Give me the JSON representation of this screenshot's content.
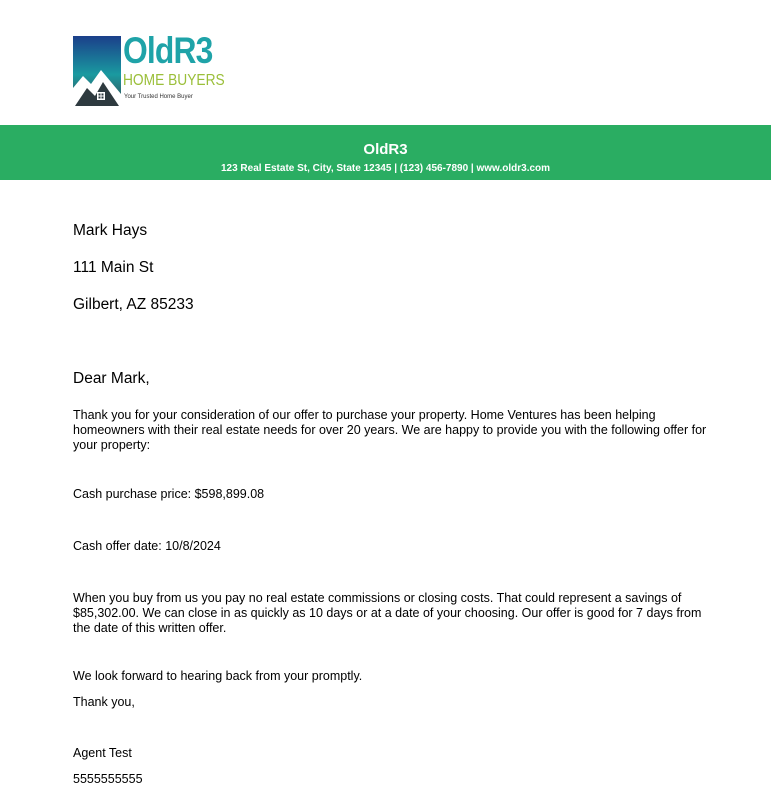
{
  "logo": {
    "name": "OldR3",
    "subtitle": "HOME BUYERS",
    "tagline": "Your Trusted Home Buyer",
    "colors": {
      "teal": "#1fa3a8",
      "green": "#9bbf3a",
      "navy": "#1b3f8a",
      "dark": "#2e3a3f"
    }
  },
  "header": {
    "company": "OldR3",
    "contact_line": "123 Real Estate St, City, State 12345 | (123) 456-7890 | www.oldr3.com",
    "background": "#2aad62"
  },
  "recipient": {
    "name": "Mark Hays",
    "street": "111 Main St",
    "city_state_zip": "Gilbert, AZ 85233"
  },
  "letter": {
    "salutation": "Dear Mark,",
    "intro": "Thank you for your consideration of our offer to purchase your property. Home Ventures has been helping homeowners with their real estate needs for over 20 years. We are happy to provide you with the following offer for your property:",
    "cash_price": "Cash purchase price: $598,899.08",
    "offer_date": "Cash offer date: 10/8/2024",
    "body": "When you buy from us you pay no real estate commissions or closing costs. That could represent a savings of $85,302.00. We can close in as quickly as 10 days or at a date of your choosing. Our offer is good for 7 days from the date of this written offer.",
    "closing_line": "We look forward to hearing back from your promptly.",
    "sign_off": "Thank you,"
  },
  "agent": {
    "name": "Agent Test",
    "phone": "5555555555"
  }
}
